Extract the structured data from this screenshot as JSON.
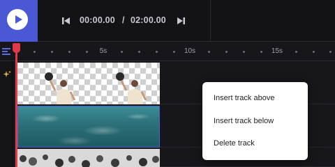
{
  "transport": {
    "current_time": "00:00.00",
    "separator": "/",
    "total_time": "02:00.00",
    "icons": [
      "play-icon",
      "skip-back-icon",
      "skip-forward-icon"
    ]
  },
  "ruler": {
    "labels": [
      "5s",
      "10s",
      "15s"
    ],
    "icons": [
      "track-menu-icon"
    ]
  },
  "tracks": [
    {
      "clip": "person-on-transparent",
      "icons": [
        "sparkle-icon"
      ]
    },
    {
      "clip": "ocean-waves",
      "selected": true
    },
    {
      "clip": "crowd"
    }
  ],
  "context_menu": {
    "items": [
      "Insert track above",
      "Insert track below",
      "Delete track"
    ]
  },
  "colors": {
    "accent": "#4a58d6",
    "playhead": "#e03a48",
    "background": "#17171b",
    "selection": "#4a63d8"
  }
}
